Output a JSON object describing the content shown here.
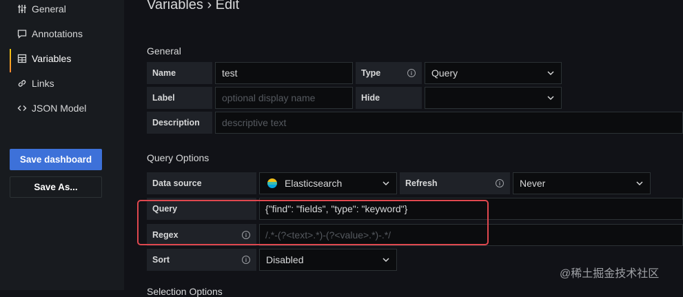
{
  "sidebar": {
    "items": [
      {
        "label": "General",
        "icon": "sliders-icon"
      },
      {
        "label": "Annotations",
        "icon": "comment-icon"
      },
      {
        "label": "Variables",
        "icon": "calculator-icon"
      },
      {
        "label": "Links",
        "icon": "link-icon"
      },
      {
        "label": "JSON Model",
        "icon": "code-icon"
      }
    ],
    "save_label": "Save dashboard",
    "save_as_label": "Save As..."
  },
  "header": {
    "title": "Variables › Edit"
  },
  "general": {
    "heading": "General",
    "name_label": "Name",
    "name_value": "test",
    "type_label": "Type",
    "type_value": "Query",
    "label_label": "Label",
    "label_placeholder": "optional display name",
    "hide_label": "Hide",
    "hide_value": "",
    "description_label": "Description",
    "description_placeholder": "descriptive text"
  },
  "query_options": {
    "heading": "Query Options",
    "datasource_label": "Data source",
    "datasource_value": "Elasticsearch",
    "refresh_label": "Refresh",
    "refresh_value": "Never",
    "query_label": "Query",
    "query_value": "{\"find\": \"fields\", \"type\": \"keyword\"}",
    "regex_label": "Regex",
    "regex_placeholder": "/.*-(?<text>.*)-(?<value>.*)-.*/",
    "sort_label": "Sort",
    "sort_value": "Disabled"
  },
  "next_section": {
    "heading": "Selection Options"
  },
  "watermark": "@稀土掘金技术社区",
  "colors": {
    "accent": "#3d71d9",
    "highlight": "#e0484f",
    "active_bar": "#f2cc0c"
  }
}
